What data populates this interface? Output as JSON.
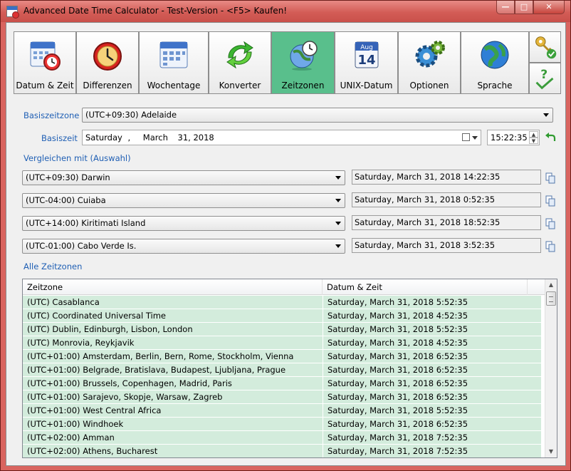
{
  "window": {
    "title": "Advanced Date Time Calculator - Test-Version - <F5> Kaufen!",
    "controls": {
      "minimize": "—",
      "maximize": "□",
      "close": "✕"
    }
  },
  "toolbar": {
    "tabs": [
      {
        "label": "Datum & Zeit",
        "icon": "calendar-clock-icon"
      },
      {
        "label": "Differenzen",
        "icon": "alarm-clock-icon"
      },
      {
        "label": "Wochentage",
        "icon": "calendar-icon"
      },
      {
        "label": "Konverter",
        "icon": "green-arrows-icon"
      },
      {
        "label": "Zeitzonen",
        "icon": "globe-clock-icon",
        "active": true
      },
      {
        "label": "UNIX-Datum",
        "icon": "aug-14-calendar-icon"
      },
      {
        "label": "Optionen",
        "icon": "gears-icon"
      },
      {
        "label": "Sprache",
        "icon": "globe-icon"
      }
    ],
    "side_icons": [
      "keys-check-icon",
      "help-check-icon"
    ],
    "active_color": "#59bf8c"
  },
  "base": {
    "zone_label": "Basiszeitzone",
    "zone_value": "(UTC+09:30) Adelaide",
    "time_label": "Basiszeit",
    "date_weekday": "Saturday",
    "date_sep": ",",
    "date_month": "March",
    "date_day_year": "31, 2018",
    "time_value": "15:22:35"
  },
  "compare": {
    "label": "Vergleichen mit (Auswahl)",
    "rows": [
      {
        "zone": "(UTC+09:30) Darwin",
        "result": "Saturday, March 31, 2018 14:22:35"
      },
      {
        "zone": "(UTC-04:00) Cuiaba",
        "result": "Saturday, March 31, 2018 0:52:35"
      },
      {
        "zone": "(UTC+14:00) Kiritimati Island",
        "result": "Saturday, March 31, 2018 18:52:35"
      },
      {
        "zone": "(UTC-01:00) Cabo Verde Is.",
        "result": "Saturday, March 31, 2018 3:52:35"
      }
    ]
  },
  "all": {
    "label": "Alle Zeitzonen",
    "columns": [
      "Zeitzone",
      "Datum & Zeit"
    ],
    "rows": [
      [
        "(UTC) Casablanca",
        "Saturday, March 31, 2018 5:52:35"
      ],
      [
        "(UTC) Coordinated Universal Time",
        "Saturday, March 31, 2018 4:52:35"
      ],
      [
        "(UTC) Dublin, Edinburgh, Lisbon, London",
        "Saturday, March 31, 2018 5:52:35"
      ],
      [
        "(UTC) Monrovia, Reykjavik",
        "Saturday, March 31, 2018 4:52:35"
      ],
      [
        "(UTC+01:00) Amsterdam, Berlin, Bern, Rome, Stockholm, Vienna",
        "Saturday, March 31, 2018 6:52:35"
      ],
      [
        "(UTC+01:00) Belgrade, Bratislava, Budapest, Ljubljana, Prague",
        "Saturday, March 31, 2018 6:52:35"
      ],
      [
        "(UTC+01:00) Brussels, Copenhagen, Madrid, Paris",
        "Saturday, March 31, 2018 6:52:35"
      ],
      [
        "(UTC+01:00) Sarajevo, Skopje, Warsaw, Zagreb",
        "Saturday, March 31, 2018 6:52:35"
      ],
      [
        "(UTC+01:00) West Central Africa",
        "Saturday, March 31, 2018 5:52:35"
      ],
      [
        "(UTC+01:00) Windhoek",
        "Saturday, March 31, 2018 6:52:35"
      ],
      [
        "(UTC+02:00) Amman",
        "Saturday, March 31, 2018 7:52:35"
      ],
      [
        "(UTC+02:00) Athens, Bucharest",
        "Saturday, March 31, 2018 7:52:35"
      ]
    ],
    "row_color": "#d3ecdc"
  }
}
